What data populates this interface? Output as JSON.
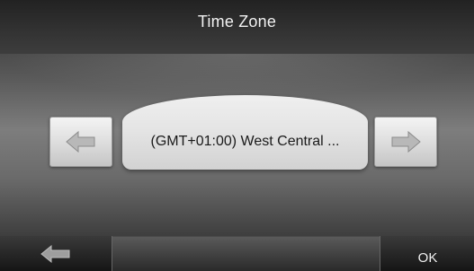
{
  "header": {
    "title": "Time Zone"
  },
  "selector": {
    "value": "(GMT+01:00) West Central ...",
    "prev_icon": "arrow-left-icon",
    "next_icon": "arrow-right-icon"
  },
  "footer": {
    "back_icon": "back-arrow-icon",
    "ok_label": "OK"
  }
}
